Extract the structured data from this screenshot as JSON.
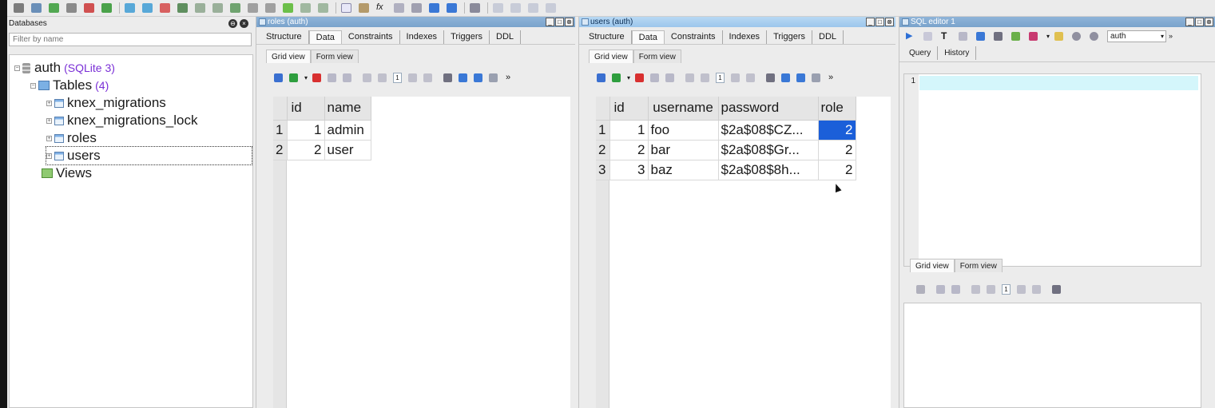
{
  "databases": {
    "header": "Databases",
    "filter_placeholder": "Filter by name",
    "tree": {
      "db_name": "auth",
      "db_type": "(SQLite 3)",
      "tables_label": "Tables",
      "tables_count": "(4)",
      "tables": [
        "knex_migrations",
        "knex_migrations_lock",
        "roles",
        "users"
      ],
      "views_label": "Views"
    }
  },
  "roles_panel": {
    "title": "roles (auth)",
    "tabs": [
      "Structure",
      "Data",
      "Constraints",
      "Indexes",
      "Triggers",
      "DDL"
    ],
    "subtabs": [
      "Grid view",
      "Form view"
    ],
    "page": "1",
    "columns": [
      "id",
      "name"
    ],
    "rows": [
      {
        "rownum": "1",
        "id": "1",
        "name": "admin"
      },
      {
        "rownum": "2",
        "id": "2",
        "name": "user"
      }
    ]
  },
  "users_panel": {
    "title": "users (auth)",
    "tabs": [
      "Structure",
      "Data",
      "Constraints",
      "Indexes",
      "Triggers",
      "DDL"
    ],
    "subtabs": [
      "Grid view",
      "Form view"
    ],
    "page": "1",
    "columns": [
      "id",
      "username",
      "password",
      "role"
    ],
    "rows": [
      {
        "rownum": "1",
        "id": "1",
        "username": "foo",
        "password": "$2a$08$CZ...",
        "role": "2"
      },
      {
        "rownum": "2",
        "id": "2",
        "username": "bar",
        "password": "$2a$08$Gr...",
        "role": "2"
      },
      {
        "rownum": "3",
        "id": "3",
        "username": "baz",
        "password": "$2a$08$8h...",
        "role": "2"
      }
    ]
  },
  "sql_editor": {
    "title": "SQL editor 1",
    "db_select": "auth",
    "tabs": [
      "Query",
      "History"
    ],
    "line_number": "1",
    "result_tabs": [
      "Grid view",
      "Form view"
    ],
    "page": "1"
  },
  "window_buttons": {
    "minimize": "_",
    "restore": "□",
    "close": "⊗"
  },
  "colors": {
    "selection": "#1b5fd9",
    "active_title": "#b7d8f3",
    "inactive_title": "#8fb4d8",
    "tables_count": "#7a2fd6"
  }
}
